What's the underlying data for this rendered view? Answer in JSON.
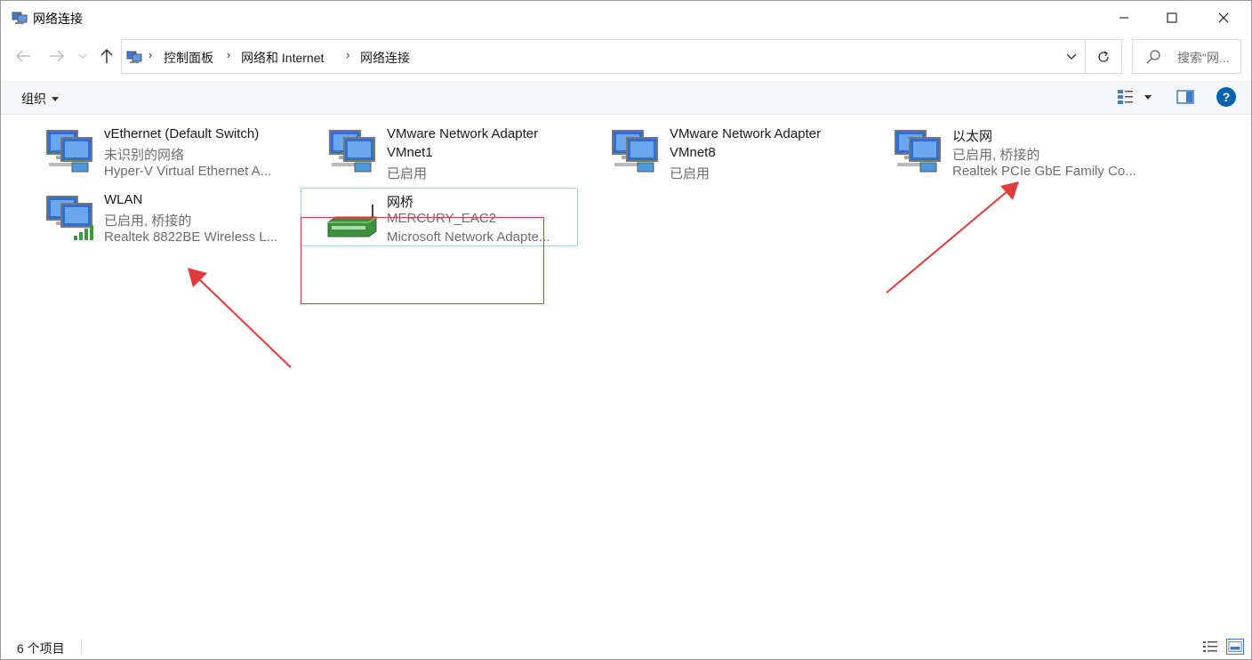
{
  "window": {
    "title": "网络连接",
    "minimize_icon": "minimize-icon",
    "maximize_icon": "maximize-icon",
    "close_icon": "close-icon"
  },
  "nav": {
    "back_icon": "arrow-left-icon",
    "forward_icon": "arrow-right-icon",
    "recent_icon": "chevron-down-icon",
    "up_icon": "arrow-up-icon"
  },
  "breadcrumb": [
    "控制面板",
    "网络和 Internet",
    "网络连接"
  ],
  "search": {
    "placeholder": "搜索\"网..."
  },
  "toolbar": {
    "organize_label": "组织"
  },
  "items": [
    {
      "name": "vEthernet (Default Switch)",
      "line2": "未识别的网络",
      "line3": "Hyper-V Virtual Ethernet A...",
      "icon": "network-adapter-icon"
    },
    {
      "name": "VMware Network Adapter",
      "line2": "VMnet1",
      "line3": "已启用",
      "icon": "network-adapter-icon"
    },
    {
      "name": "VMware Network Adapter",
      "line2": "VMnet8",
      "line3": "已启用",
      "icon": "network-adapter-icon"
    },
    {
      "name": "以太网",
      "line2": "已启用, 桥接的",
      "line3": "Realtek PCIe GbE Family Co...",
      "icon": "network-adapter-icon"
    },
    {
      "name": "WLAN",
      "line2": "已启用, 桥接的",
      "line3": "Realtek 8822BE Wireless L...",
      "icon": "wireless-adapter-icon"
    },
    {
      "name": "网桥",
      "line2": "MERCURY_EAC2",
      "line3": "Microsoft Network Adapte...",
      "icon": "network-bridge-icon"
    }
  ],
  "status": {
    "count": "6 个项目"
  },
  "colors": {
    "annotation": "#e03a3a",
    "selection_border": "#99d1ff",
    "accent": "#0063b1"
  }
}
